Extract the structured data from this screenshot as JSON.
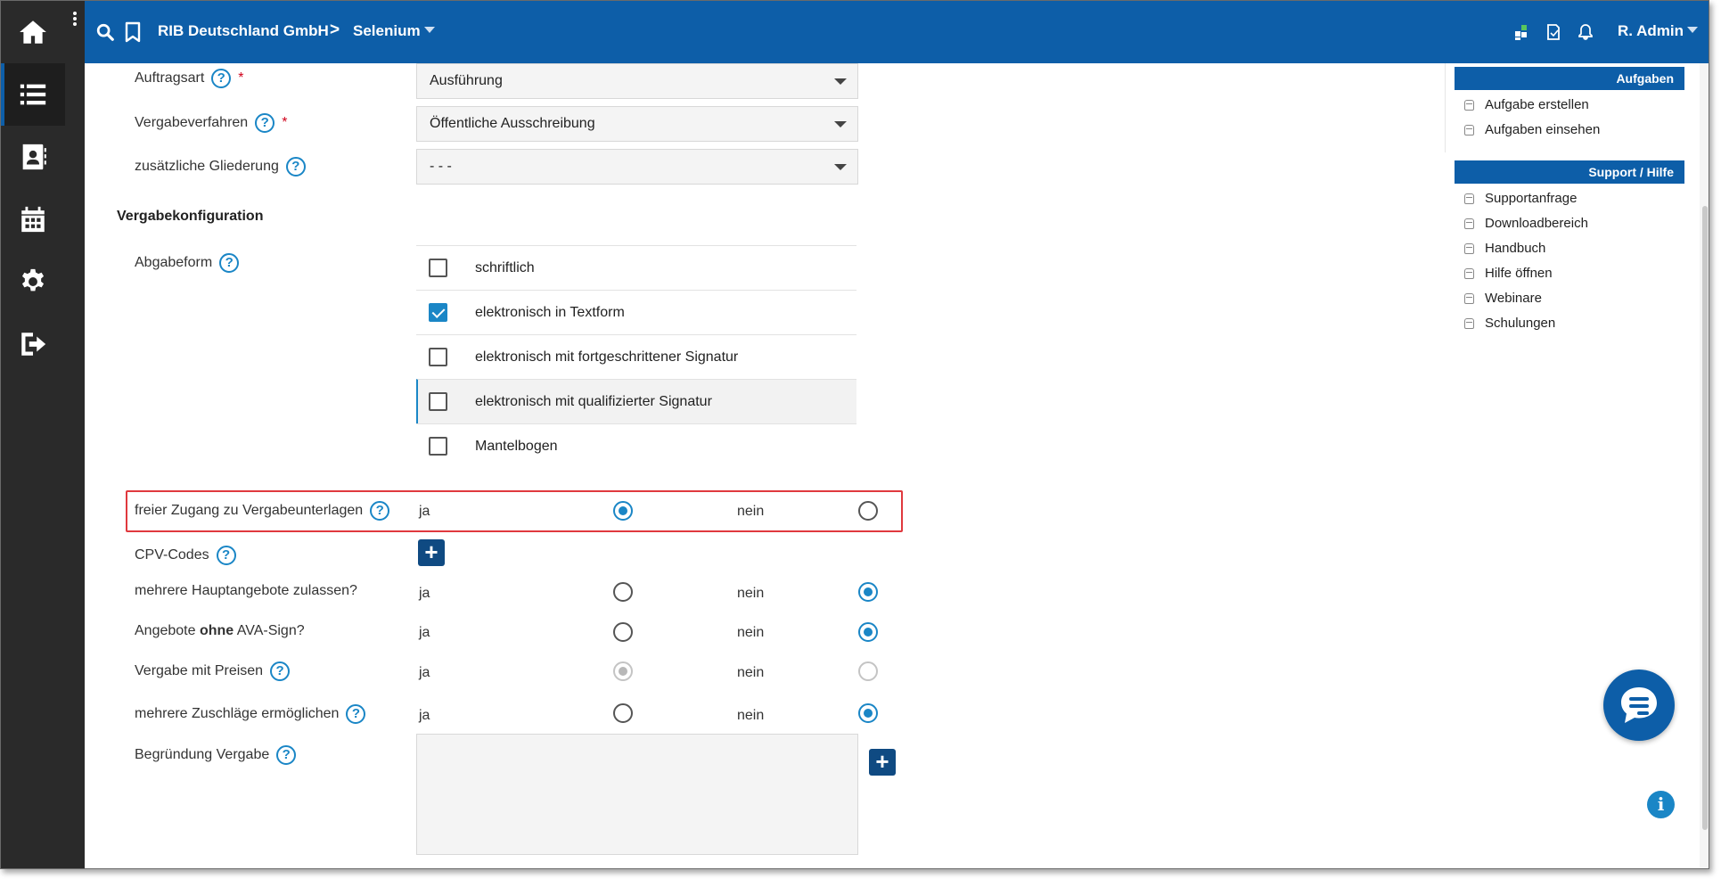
{
  "topbar": {
    "org": "RIB Deutschland GmbH",
    "separator": ">",
    "project": "Selenium",
    "user": "R. Admin"
  },
  "form": {
    "auftragsart": {
      "label": "Auftragsart",
      "value": "Ausführung",
      "required": "*"
    },
    "vergabeverfahren": {
      "label": "Vergabeverfahren",
      "value": "Öffentliche Ausschreibung",
      "required": "*"
    },
    "gliederung": {
      "label": "zusätzliche Gliederung",
      "value": "- - -"
    },
    "section_title": "Vergabekonfiguration",
    "abgabeform": {
      "label": "Abgabeform",
      "options": [
        {
          "label": "schriftlich",
          "checked": false
        },
        {
          "label": "elektronisch in Textform",
          "checked": true
        },
        {
          "label": "elektronisch mit fortgeschrittener Signatur",
          "checked": false
        },
        {
          "label": "elektronisch mit qualifizierter Signatur",
          "checked": false
        },
        {
          "label": "Mantelbogen",
          "checked": false
        }
      ]
    },
    "yes_label": "ja",
    "no_label": "nein",
    "freier_zugang": {
      "label": "freier Zugang zu Vergabeunterlagen",
      "value": "ja"
    },
    "cpv": {
      "label": "CPV-Codes"
    },
    "hauptangebote": {
      "label": "mehrere Hauptangebote zulassen?",
      "value": "nein"
    },
    "ava_sign": {
      "label_pre": "Angebote ",
      "label_bold": "ohne",
      "label_post": " AVA-Sign?",
      "value": "nein"
    },
    "preisen": {
      "label": "Vergabe mit Preisen",
      "value": "ja",
      "disabled": true
    },
    "zuschlaege": {
      "label": "mehrere Zuschläge ermöglichen",
      "value": "nein"
    },
    "begruendung": {
      "label": "Begründung Vergabe",
      "value": ""
    }
  },
  "sidebar": {
    "aufgaben_title": "Aufgaben",
    "aufgaben_items": [
      "Aufgabe erstellen",
      "Aufgaben einsehen"
    ],
    "support_title": "Support / Hilfe",
    "support_items": [
      "Supportanfrage",
      "Downloadbereich",
      "Handbuch",
      "Hilfe öffnen",
      "Webinare",
      "Schulungen"
    ]
  },
  "icons": {
    "help": "?",
    "plus": "+",
    "info": "i"
  },
  "colors": {
    "brand": "#0d5ea8",
    "accent": "#1a86c6",
    "required": "#d0021b",
    "highlight_box": "#e0393e"
  }
}
